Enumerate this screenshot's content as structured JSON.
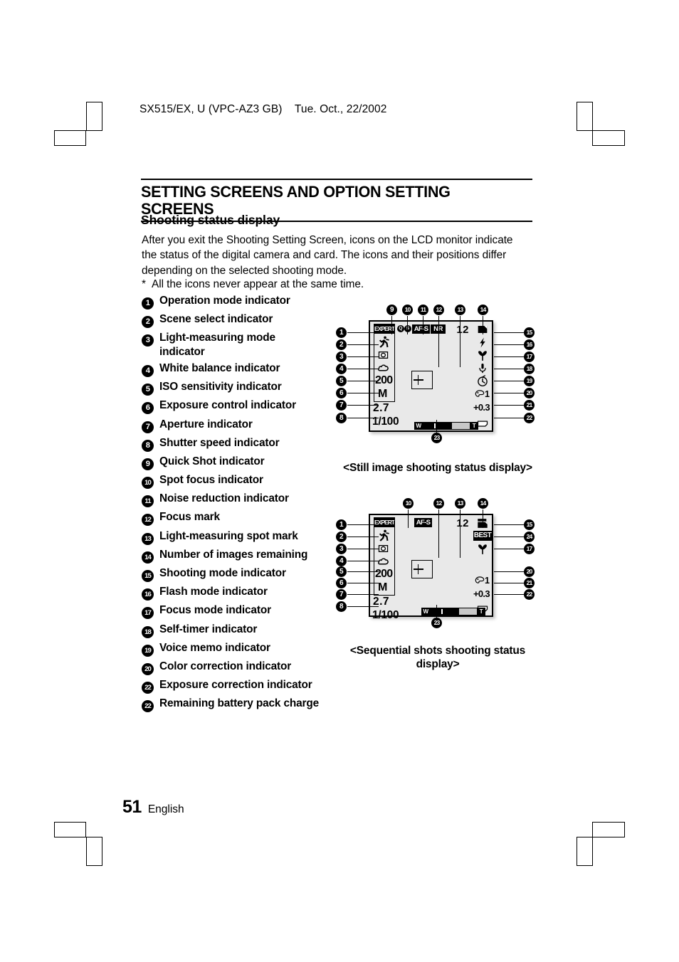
{
  "page_header": "SX515/EX, U (VPC-AZ3 GB)    Tue. Oct., 22/2002",
  "main_title": "SETTING SCREENS AND OPTION SETTING SCREENS",
  "subheading": "Shooting status display",
  "body_paragraph": "After you exit the Shooting Setting Screen, icons on the LCD monitor indicate the status of the digital camera and card. The icons and their positions differ depending on the selected shooting mode.",
  "note": {
    "marker": "*",
    "text": "All the icons never appear at the same time."
  },
  "legend": [
    {
      "num": "1",
      "label": "Operation mode indicator"
    },
    {
      "num": "2",
      "label": "Scene select indicator"
    },
    {
      "num": "3",
      "label": "Light-measuring mode",
      "label_cont": "indicator"
    },
    {
      "num": "4",
      "label": "White balance indicator"
    },
    {
      "num": "5",
      "label": "ISO sensitivity indicator"
    },
    {
      "num": "6",
      "label": "Exposure control indicator"
    },
    {
      "num": "7",
      "label": "Aperture indicator"
    },
    {
      "num": "8",
      "label": "Shutter speed indicator"
    },
    {
      "num": "9",
      "label": "Quick Shot indicator"
    },
    {
      "num": "10",
      "label": "Spot focus indicator"
    },
    {
      "num": "11",
      "label": "Noise reduction indicator"
    },
    {
      "num": "12",
      "label": "Focus mark"
    },
    {
      "num": "13",
      "label": "Light-measuring spot mark"
    },
    {
      "num": "14",
      "label": "Number of images remaining"
    },
    {
      "num": "15",
      "label": "Shooting mode indicator"
    },
    {
      "num": "16",
      "label": "Flash mode indicator"
    },
    {
      "num": "17",
      "label": "Focus mode indicator"
    },
    {
      "num": "18",
      "label": "Self-timer indicator"
    },
    {
      "num": "19",
      "label": "Voice memo indicator"
    },
    {
      "num": "20",
      "label": "Color correction indicator"
    },
    {
      "num": "22",
      "label": "Exposure correction indicator"
    },
    {
      "num": "22",
      "label": "Remaining battery pack charge"
    }
  ],
  "diagram1": {
    "caption": "<Still image shooting status display>",
    "screen": {
      "operation_mode": "EXPERT",
      "quick_shot": "QS",
      "focus_mode_top": "AF-S",
      "noise_reduction": "NR",
      "iso": "200",
      "exposure_control": "M",
      "aperture": "2.7",
      "shutter_speed": "1/100",
      "images_remaining": "12",
      "color_correction": "1",
      "exposure_correction": "+0.3",
      "zoom_wide_label": "W",
      "zoom_tele_label": "T",
      "scene_icon": "running-person-icon",
      "light_measuring_icon": "spot-metering-icon",
      "white_balance_icon": "cloudy-icon",
      "shooting_mode_icon": "single-shot-icon",
      "flash_icon": "flash-bolt-icon",
      "focus_mode_icon": "macro-flower-icon",
      "voice_memo_icon": "microphone-icon",
      "self_timer_icon": "stopwatch-icon",
      "color_correction_icon": "palette-icon",
      "battery_icon": "battery-icon"
    },
    "callouts_left": [
      "1",
      "2",
      "3",
      "4",
      "5",
      "6",
      "7",
      "8"
    ],
    "callouts_top": [
      "9",
      "10",
      "11",
      "12",
      "13",
      "14"
    ],
    "callouts_right": [
      "15",
      "16",
      "17",
      "18",
      "19",
      "20",
      "21",
      "22"
    ],
    "callout_bottom": "23"
  },
  "diagram2": {
    "caption_line1": "<Sequential shots shooting status",
    "caption_line2": "display>",
    "screen": {
      "operation_mode": "EXPERT",
      "focus_mode_top": "AF-S",
      "iso": "200",
      "exposure_control": "M",
      "aperture": "2.7",
      "shutter_speed": "1/100",
      "images_remaining": "12",
      "best_shot": "BEST",
      "color_correction": "1",
      "exposure_correction": "+0.3",
      "zoom_wide_label": "W",
      "zoom_tele_label": "T",
      "scene_icon": "running-person-icon",
      "light_measuring_icon": "spot-metering-icon",
      "white_balance_icon": "cloudy-icon",
      "shooting_mode_icon": "sequential-shots-icon",
      "focus_mode_icon": "macro-flower-icon",
      "color_correction_icon": "palette-icon",
      "battery_icon": "battery-icon"
    },
    "callouts_left": [
      "1",
      "2",
      "3",
      "4",
      "5",
      "6",
      "7",
      "8"
    ],
    "callouts_top": [
      "10",
      "12",
      "13",
      "14"
    ],
    "callouts_right": [
      "15",
      "24",
      "17",
      "20",
      "21",
      "22"
    ],
    "callout_bottom": "23"
  },
  "footer": {
    "page_number": "51",
    "language": "English"
  }
}
